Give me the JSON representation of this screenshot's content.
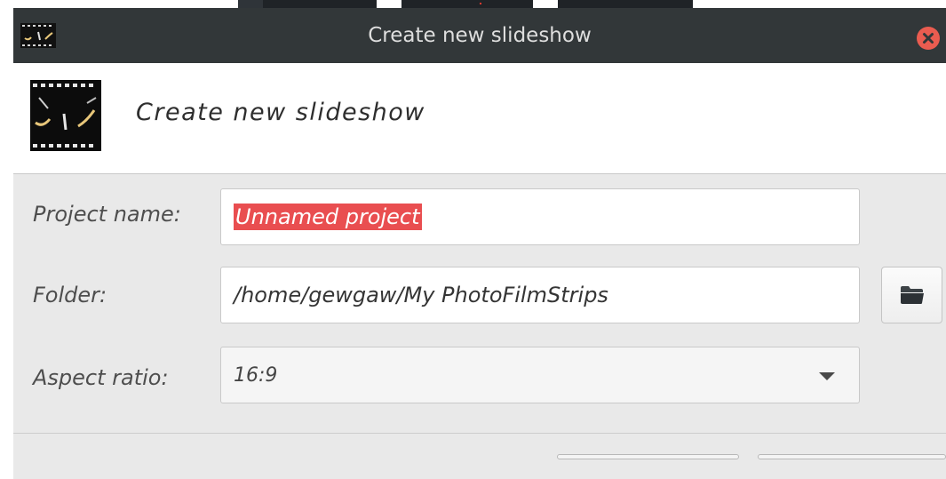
{
  "window": {
    "title": "Create new slideshow",
    "close_icon": "close-icon"
  },
  "header": {
    "title": "Create new slideshow",
    "icon": "filmstrip-icon"
  },
  "form": {
    "project_name": {
      "label": "Project name:",
      "value": "Unnamed project",
      "selected": true
    },
    "folder": {
      "label": "Folder:",
      "value": "/home/gewgaw/My PhotoFilmStrips",
      "browse_icon": "folder-open-icon"
    },
    "aspect_ratio": {
      "label": "Aspect ratio:",
      "value": "16:9",
      "arrow_icon": "chevron-down-icon"
    }
  },
  "colors": {
    "titlebar": "#323739",
    "close": "#ea5c50",
    "selection": "#e94e50",
    "dialog_bg": "#e9e9e9"
  }
}
